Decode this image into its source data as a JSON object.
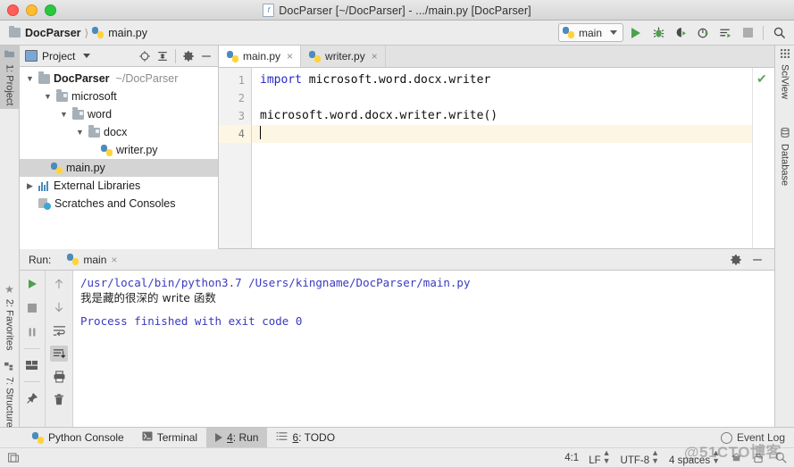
{
  "window": {
    "title": "DocParser [~/DocParser] - .../main.py [DocParser]",
    "title_icon": "python-file-icon"
  },
  "navbar": {
    "crumbs": [
      {
        "label": "DocParser",
        "icon": "folder-icon",
        "bold": true
      },
      {
        "label": "main.py",
        "icon": "python-file-icon",
        "bold": false
      }
    ],
    "run_config": {
      "label": "main",
      "icon": "python-icon"
    },
    "buttons": [
      {
        "name": "run-button",
        "icon": "play-triangle"
      },
      {
        "name": "debug-button",
        "icon": "bug-icon"
      },
      {
        "name": "run-coverage-button",
        "icon": "run-coverage-icon"
      },
      {
        "name": "profile-button",
        "icon": "profile-icon"
      },
      {
        "name": "run-with-console-button",
        "icon": "run-console-icon"
      },
      {
        "name": "stop-button",
        "icon": "stop-square"
      },
      {
        "name": "search-everywhere-button",
        "icon": "magnifier-icon"
      }
    ]
  },
  "left_strip": {
    "tabs": [
      {
        "label": "1: Project",
        "shortcut": "1",
        "icon": "project-folder-icon",
        "active": true
      },
      {
        "label": "2: Favorites",
        "shortcut": "2",
        "icon": "star-icon",
        "active": false
      },
      {
        "label": "7: Structure",
        "shortcut": "7",
        "icon": "structure-icon",
        "active": false
      }
    ]
  },
  "right_strip": {
    "tabs": [
      {
        "label": "SciView",
        "icon": "grid-icon"
      },
      {
        "label": "Database",
        "icon": "database-icon"
      }
    ]
  },
  "project_panel": {
    "title": "Project",
    "header_icons": [
      "locate-icon",
      "collapse-all-icon",
      "settings-gear-icon",
      "hide-icon"
    ],
    "tree": [
      {
        "label": "DocParser",
        "suffix": "~/DocParser",
        "depth": 0,
        "twisty": "down",
        "icon": "folder-icon",
        "bold": true,
        "selected": false
      },
      {
        "label": "microsoft",
        "suffix": "",
        "depth": 1,
        "twisty": "down",
        "icon": "package-folder-icon",
        "bold": false,
        "selected": false
      },
      {
        "label": "word",
        "suffix": "",
        "depth": 2,
        "twisty": "down",
        "icon": "package-folder-icon",
        "bold": false,
        "selected": false
      },
      {
        "label": "docx",
        "suffix": "",
        "depth": 3,
        "twisty": "down",
        "icon": "package-folder-icon",
        "bold": false,
        "selected": false
      },
      {
        "label": "writer.py",
        "suffix": "",
        "depth": 4,
        "twisty": "",
        "icon": "python-file-icon",
        "bold": false,
        "selected": false
      },
      {
        "label": "main.py",
        "suffix": "",
        "depth": 1,
        "twisty": "",
        "icon": "python-file-icon",
        "bold": false,
        "selected": true
      },
      {
        "label": "External Libraries",
        "suffix": "",
        "depth": 0,
        "twisty": "right",
        "icon": "libraries-icon",
        "bold": false,
        "selected": false
      },
      {
        "label": "Scratches and Consoles",
        "suffix": "",
        "depth": 0,
        "twisty": "",
        "icon": "scratches-icon",
        "bold": false,
        "selected": false
      }
    ]
  },
  "editor": {
    "tabs": [
      {
        "label": "main.py",
        "icon": "python-file-icon",
        "active": true,
        "close": "×"
      },
      {
        "label": "writer.py",
        "icon": "python-file-icon",
        "active": false,
        "close": "×"
      }
    ],
    "gutter": [
      "1",
      "2",
      "3",
      "4"
    ],
    "current_line": 4,
    "lines": [
      {
        "no": 1,
        "keyword": "import",
        "rest": " microsoft.word.docx.writer"
      },
      {
        "no": 2,
        "keyword": "",
        "rest": ""
      },
      {
        "no": 3,
        "keyword": "",
        "rest": "microsoft.word.docx.writer.write()"
      },
      {
        "no": 4,
        "keyword": "",
        "rest": ""
      }
    ],
    "inspection_status": "✔"
  },
  "run_window": {
    "label": "Run:",
    "tab": {
      "label": "main",
      "icon": "python-icon",
      "close": "×"
    },
    "header_icons": [
      "settings-gear-icon",
      "hide-icon"
    ],
    "left_toolbar": [
      "rerun-play-icon",
      "stop-icon",
      "pause-icon",
      "layout-icon",
      "pin-icon"
    ],
    "right_toolbar": [
      "up-arrow-icon",
      "down-arrow-icon",
      "soft-wrap-icon",
      "scroll-to-end-icon",
      "print-icon",
      "trash-icon"
    ],
    "console": [
      {
        "text": "/usr/local/bin/python3.7 /Users/kingname/DocParser/main.py",
        "style": "link"
      },
      {
        "text": "我是藏的很深的 write 函数",
        "style": "plain"
      },
      {
        "text": "",
        "style": "blank"
      },
      {
        "text": "Process finished with exit code 0",
        "style": "link"
      }
    ]
  },
  "bottom_bar": {
    "items": [
      {
        "label": "Python Console",
        "icon": "python-console-icon",
        "active": false
      },
      {
        "label": "Terminal",
        "icon": "terminal-icon",
        "active": false
      },
      {
        "label": "4: Run",
        "shortcut": "4",
        "icon": "play-triangle-small",
        "active": true
      },
      {
        "label": "6: TODO",
        "shortcut": "6",
        "icon": "todo-list-icon",
        "active": false
      }
    ],
    "event_log": {
      "label": "Event Log",
      "icon": "event-log-icon"
    }
  },
  "status_bar": {
    "left_icon": "toggle-window-icon",
    "caret_position": "4:1",
    "line_separator": "LF",
    "encoding": "UTF-8",
    "indent": "4 spaces",
    "right_icons": [
      "branch-icon",
      "lock-icon",
      "inspection-icon"
    ]
  },
  "watermark": "@51CTO博客",
  "colors": {
    "accent_green": "#4ca14c",
    "keyword_blue": "#2525cc",
    "console_link": "#3a3ac0",
    "selection_gray": "#d4d4d4",
    "current_line": "#fdf6e3",
    "chrome": "#ececec"
  }
}
